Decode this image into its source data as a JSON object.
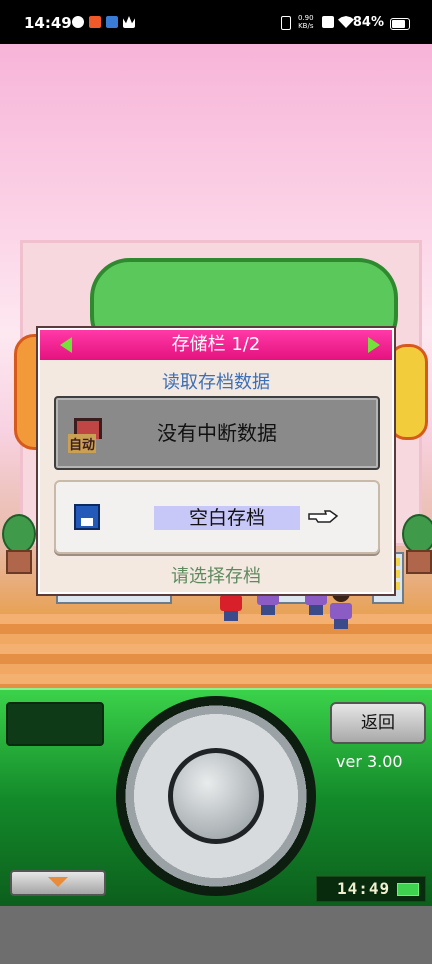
{
  "status_bar": {
    "time": "14:49",
    "net_speed_value": "0.90",
    "net_speed_unit": "KB/s",
    "battery": "84%"
  },
  "dialog": {
    "title": "存储栏 1/2",
    "load_label": "读取存档数据",
    "slot_auto": {
      "icon_label": "自动",
      "text": "没有中断数据"
    },
    "slot_blank": {
      "text": "空白存档"
    },
    "select_label": "请选择存档"
  },
  "controller": {
    "back_label": "返回",
    "version": "ver 3.00",
    "clock": "14:49"
  },
  "colors": {
    "header_pink": "#e4127f",
    "arrow_green": "#74e23a",
    "label_blue": "#3c6fb8",
    "controller_green": "#138a2a"
  },
  "icons": [
    "left-arrow-icon",
    "right-arrow-icon",
    "save-disk-icon",
    "pointing-hand-icon",
    "auto-save-icon",
    "down-arrow-icon"
  ]
}
